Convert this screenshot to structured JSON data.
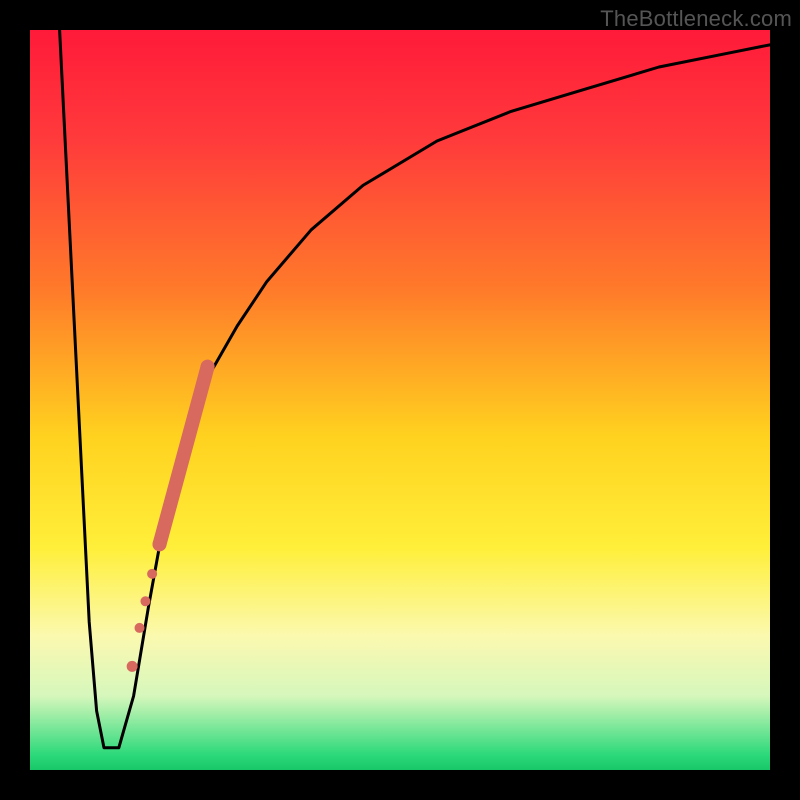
{
  "watermark": "TheBottleneck.com",
  "gradient_stops": [
    {
      "offset": 0,
      "color": "#ff1a3a"
    },
    {
      "offset": 15,
      "color": "#ff3b3b"
    },
    {
      "offset": 35,
      "color": "#ff7a2a"
    },
    {
      "offset": 55,
      "color": "#ffd21f"
    },
    {
      "offset": 70,
      "color": "#ffef3a"
    },
    {
      "offset": 82,
      "color": "#fbf9b0"
    },
    {
      "offset": 90,
      "color": "#d6f7bc"
    },
    {
      "offset": 98,
      "color": "#2bd97a"
    },
    {
      "offset": 100,
      "color": "#18c768"
    }
  ],
  "chart_data": {
    "type": "line",
    "title": "",
    "xlabel": "",
    "ylabel": "",
    "xlim": [
      0,
      100
    ],
    "ylim": [
      0,
      100
    ],
    "series": [
      {
        "name": "bottleneck-curve",
        "x": [
          4,
          5,
          6,
          7,
          8,
          9,
          10,
          12,
          14,
          16,
          18,
          20,
          24,
          28,
          32,
          38,
          45,
          55,
          65,
          75,
          85,
          95,
          100
        ],
        "values": [
          100,
          80,
          60,
          40,
          20,
          8,
          3,
          3,
          10,
          22,
          33,
          42,
          53,
          60,
          66,
          73,
          79,
          85,
          89,
          92,
          95,
          97,
          98
        ]
      }
    ],
    "markers": [
      {
        "name": "highlight-segment-cap-top",
        "x": 24.0,
        "y": 54.5,
        "r": 7
      },
      {
        "name": "highlight-segment-cap-bottom",
        "x": 17.5,
        "y": 30.5,
        "r": 7
      },
      {
        "name": "highlight-dot-1",
        "x": 16.5,
        "y": 26.5,
        "r": 5
      },
      {
        "name": "highlight-dot-2",
        "x": 15.6,
        "y": 22.8,
        "r": 5
      },
      {
        "name": "highlight-dot-3",
        "x": 14.8,
        "y": 19.2,
        "r": 5
      },
      {
        "name": "highlight-dot-4",
        "x": 13.8,
        "y": 14.0,
        "r": 5.5
      }
    ],
    "highlight_segment": {
      "x1": 17.5,
      "y1": 30.5,
      "x2": 24.0,
      "y2": 54.5,
      "width": 14,
      "color": "#d7695f"
    }
  }
}
